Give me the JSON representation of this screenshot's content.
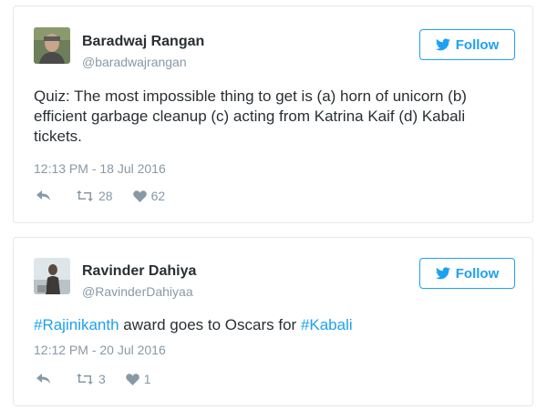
{
  "tweets": [
    {
      "author": {
        "name": "Baradwaj Rangan",
        "handle": "@baradwajrangan"
      },
      "follow_label": "Follow",
      "text": "Quiz: The most impossible thing to get is (a) horn of unicorn (b) efficient garbage cleanup (c) acting from Katrina Kaif (d) Kabali tickets.",
      "timestamp": "12:13 PM - 18 Jul 2016",
      "retweets": "28",
      "likes": "62"
    },
    {
      "author": {
        "name": "Ravinder Dahiya",
        "handle": "@RavinderDahiyaa"
      },
      "follow_label": "Follow",
      "text": {
        "hashtag1": "#Rajinikanth",
        "middle": " award goes to Oscars for ",
        "hashtag2": "#Kabali"
      },
      "timestamp": "12:12 PM - 20 Jul 2016",
      "retweets": "3",
      "likes": "1"
    }
  ],
  "icons": {
    "reply": "reply-icon",
    "retweet": "retweet-icon",
    "like": "heart-icon",
    "follow": "twitter-bird-icon"
  },
  "colors": {
    "accent": "#1da1f2",
    "text": "#292f33",
    "muted": "#8899a6",
    "border": "#e1e8ed"
  }
}
